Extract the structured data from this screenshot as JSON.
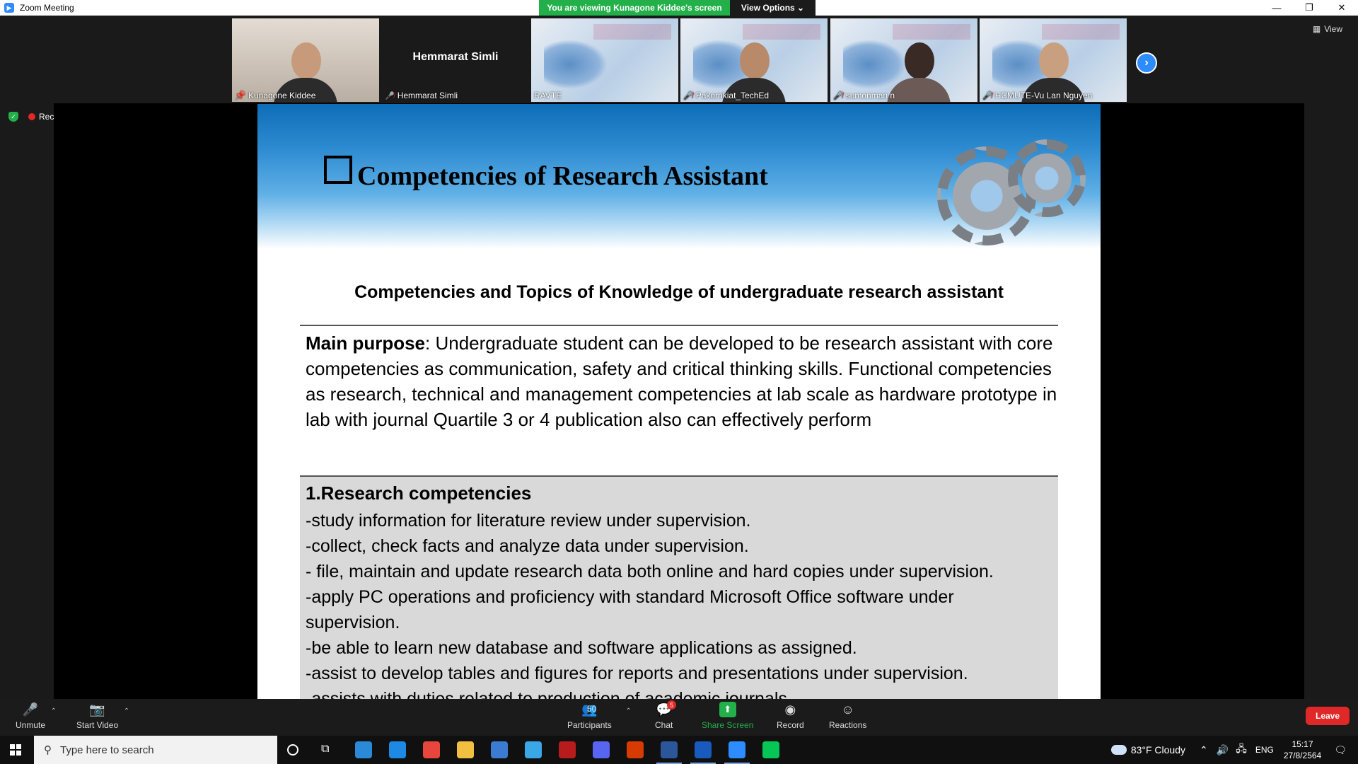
{
  "window": {
    "title": "Zoom Meeting",
    "viewing_banner": "You are viewing Kunagone Kiddee's screen",
    "view_options": "View Options ⌄",
    "controls": [
      "—",
      "❐",
      "✕"
    ]
  },
  "gallery": {
    "view_label": "View",
    "tiles": [
      {
        "name": "Kunagone Kiddee",
        "kind": "video-person",
        "pinned": true
      },
      {
        "name": "Hemmarat Simli",
        "center_name": "Hemmarat Simli",
        "kind": "name-only",
        "muted": true
      },
      {
        "name": "RAVTE",
        "kind": "slide-thumbnail"
      },
      {
        "name": "Pakornkiat_TechEd",
        "kind": "video-person",
        "muted": true
      },
      {
        "name": "sumonman n",
        "kind": "video-person",
        "muted": true
      },
      {
        "name": "HCMUTE-Vu Lan Nguyen",
        "kind": "video-person",
        "muted": true
      }
    ]
  },
  "status": {
    "recording_label": "Recording"
  },
  "slide": {
    "title": "Competencies of Research Assistant",
    "subtitle": "Competencies and Topics of Knowledge of undergraduate research assistant",
    "purpose_label": "Main purpose",
    "purpose_text": ": Undergraduate student can be developed to be research assistant with core competencies as communication, safety and critical thinking skills. Functional competencies as research, technical and management competencies at lab scale as hardware prototype in lab with journal  Quartile 3 or 4 publication also can effectively perform",
    "research_heading": "1.Research competencies",
    "research_items": [
      "-study information for literature review under supervision.",
      "-collect, check facts and analyze data under supervision.",
      "- file, maintain and update research data both online and hard copies under supervision.",
      "-apply PC operations and proficiency with standard Microsoft Office software under",
      "supervision.",
      "-be able to learn new database and software applications as assigned.",
      "-assist to develop tables and figures for reports and presentations under supervision.",
      "-assists with duties related to production of academic journals."
    ]
  },
  "toolbar": {
    "unmute": "Unmute",
    "start_video": "Start Video",
    "participants": "Participants",
    "participants_count": "50",
    "chat": "Chat",
    "chat_badge": "5",
    "share_screen": "Share Screen",
    "record": "Record",
    "reactions": "Reactions",
    "leave": "Leave"
  },
  "taskbar": {
    "search_placeholder": "Type here to search",
    "weather": "83°F  Cloudy",
    "language": "ENG",
    "time": "15:17",
    "date": "27/8/2564",
    "apps": [
      {
        "name": "edge",
        "color": "#2a8ad8"
      },
      {
        "name": "mail",
        "color": "#1e88e5"
      },
      {
        "name": "chrome",
        "color": "#e8453c"
      },
      {
        "name": "file-explorer",
        "color": "#f2c040"
      },
      {
        "name": "app-blue",
        "color": "#3b7bd1"
      },
      {
        "name": "app-cyan",
        "color": "#3aa7e6"
      },
      {
        "name": "app-red",
        "color": "#b71c1c"
      },
      {
        "name": "discord",
        "color": "#5865f2"
      },
      {
        "name": "office",
        "color": "#d83b01"
      },
      {
        "name": "word",
        "color": "#2b579a"
      },
      {
        "name": "word-doc",
        "color": "#185abd"
      },
      {
        "name": "zoom",
        "color": "#2d8cff"
      },
      {
        "name": "line",
        "color": "#06c755"
      }
    ]
  }
}
